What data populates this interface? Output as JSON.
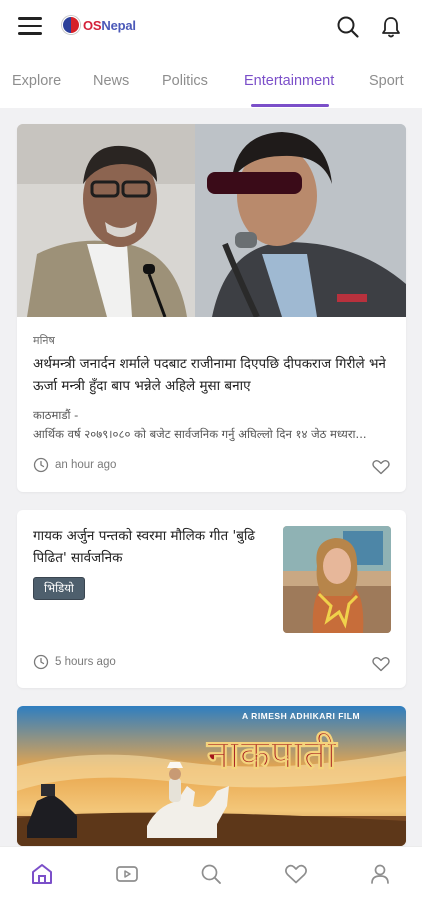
{
  "header": {
    "logo_text_os": "OS",
    "logo_text_nepal": "Nepal",
    "icons": [
      "menu-icon",
      "search-icon",
      "bell-icon"
    ]
  },
  "tabs": [
    {
      "label": "Explore"
    },
    {
      "label": "News"
    },
    {
      "label": "Politics"
    },
    {
      "label": "Entertainment",
      "active": true
    },
    {
      "label": "Sport"
    }
  ],
  "articles": [
    {
      "category": "मनिष",
      "title": "अर्थमन्त्री जनार्दन शर्माले पदबाट राजीनामा दिएपछि दीपकराज गिरीले भने ऊर्जा मन्त्री हुँदा बाप भन्नेले अहिले मुसा बनाए",
      "location": "काठमाडौं -",
      "excerpt": "आर्थिक वर्ष २०७९।०८० को बजेट सार्वजनिक गर्नु अघिल्लो दिन १४ जेठ मध्यरा...",
      "time": "an hour ago"
    },
    {
      "title": "गायक अर्जुन पन्तको स्वरमा मौलिक गीत 'बुढि पिढित' सार्वजनिक",
      "badge": "भिडियो",
      "time": "5 hours ago"
    },
    {
      "poster_credit": "A RIMESH ADHIKARI FILM",
      "poster_title": "नाकपाती"
    }
  ],
  "bottom_nav": [
    {
      "icon": "home-icon",
      "active": true
    },
    {
      "icon": "video-icon"
    },
    {
      "icon": "search-icon"
    },
    {
      "icon": "heart-icon"
    },
    {
      "icon": "profile-icon"
    }
  ],
  "colors": {
    "accent": "#7b4fc9",
    "tab_inactive": "#8e8e8e",
    "badge_bg": "#4e5f6d",
    "background": "#f1f1f3"
  }
}
